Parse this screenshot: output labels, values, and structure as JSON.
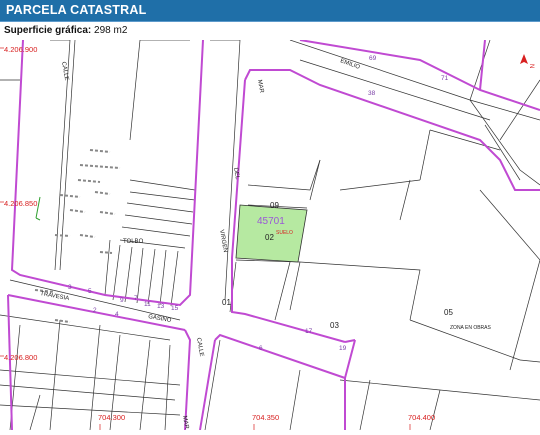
{
  "header": {
    "title": "PARCELA CATASTRAL"
  },
  "surface": {
    "label": "Superficie gráfica:",
    "value": "298 m2"
  },
  "map": {
    "north_arrow": "north-arrow",
    "coords": {
      "y_4206900": "4.206.900",
      "y_4206850": "4.206.850",
      "y_4206800": "4.206.800",
      "x_704300": "704.300",
      "x_704350": "704.350",
      "x_704400": "704.400"
    },
    "streets": {
      "calle_top": "CALLE",
      "emilio": "EMILIO",
      "mar": "MAR",
      "virgen": "VIRGEN",
      "del": "DEL",
      "travesia": "TRAVESIA",
      "gasino": "GASINO",
      "calle_bottom": "CALLE",
      "mar_bottom": "MAR",
      "tolbo": "TOLBO"
    },
    "parcel": {
      "id": "45701",
      "number": "02",
      "type": "SUELO"
    },
    "plots": {
      "p09": "09",
      "p01": "01",
      "p03": "03",
      "p05": "05"
    },
    "zona": "ZONA EN OBRAS",
    "house_numbers": {
      "n69": "69",
      "n71": "71",
      "n38": "38",
      "n9": "9",
      "n11": "11",
      "n13": "13",
      "n15": "15",
      "n5": "5",
      "n7": "7",
      "n3": "3",
      "n17": "17",
      "n19": "19",
      "n6": "6",
      "n2": "2",
      "n4": "4"
    }
  }
}
